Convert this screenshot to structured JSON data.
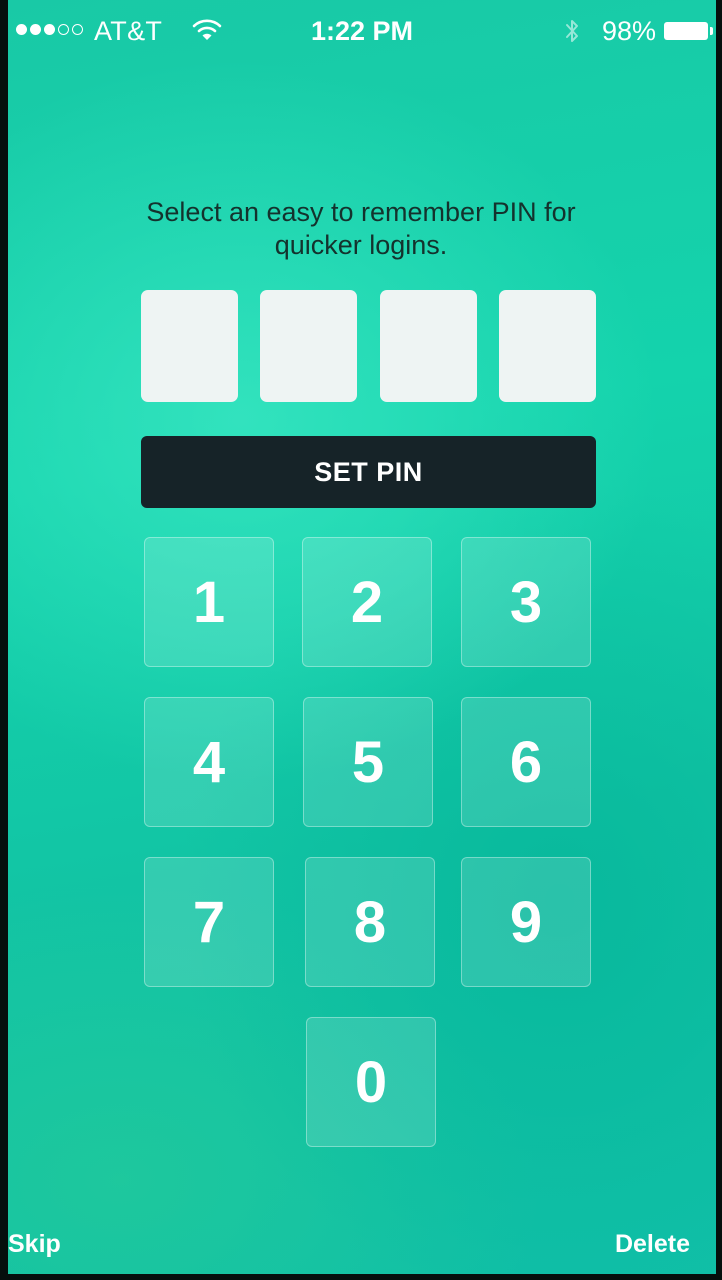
{
  "status_bar": {
    "carrier": "AT&T",
    "time": "1:22 PM",
    "battery_percent": "98%",
    "signal_bars_filled": 3,
    "signal_bars_total": 5,
    "icons": [
      "wifi-icon",
      "bluetooth-icon",
      "battery-icon"
    ]
  },
  "instruction": {
    "line1": "Select an easy to remember PIN for",
    "line2": "quicker logins."
  },
  "pin_slots": [
    "",
    "",
    "",
    ""
  ],
  "set_pin_label": "SET PIN",
  "keypad": {
    "keys": [
      "1",
      "2",
      "3",
      "4",
      "5",
      "6",
      "7",
      "8",
      "9",
      "0"
    ]
  },
  "footer": {
    "skip_label": "Skip",
    "delete_label": "Delete"
  },
  "colors": {
    "background": "#1fceaa",
    "button_dark": "#162328",
    "pin_box": "#eef4f3",
    "text_dark": "#14322d"
  }
}
